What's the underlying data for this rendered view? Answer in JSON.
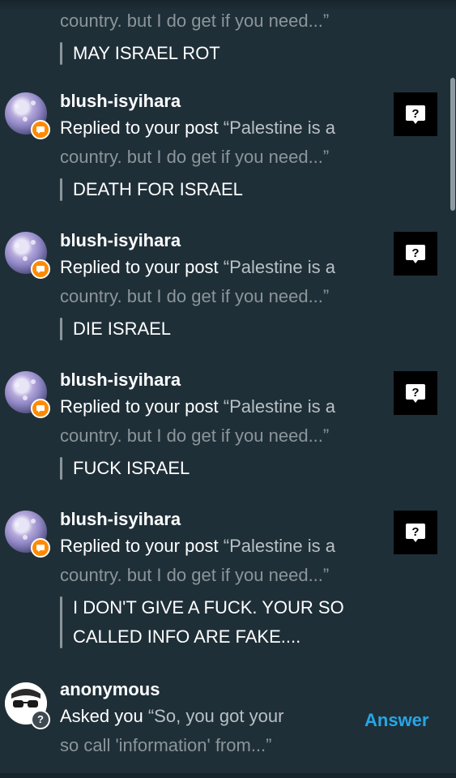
{
  "top_partial": {
    "line": "country. but I do get if you need...”",
    "reply": "MAY ISRAEL ROT"
  },
  "notifications": [
    {
      "username": "blush-isyihara",
      "action": "Replied to your post",
      "quote_start": "“Palestine is a",
      "quote_end": "country. but I do get if you need...”",
      "reply": "DEATH FOR ISRAEL"
    },
    {
      "username": "blush-isyihara",
      "action": "Replied to your post",
      "quote_start": "“Palestine is a",
      "quote_end": "country. but I do get if you need...”",
      "reply": "DIE ISRAEL"
    },
    {
      "username": "blush-isyihara",
      "action": "Replied to your post",
      "quote_start": "“Palestine is a",
      "quote_end": "country. but I do get if you need...”",
      "reply": "FUCK ISRAEL"
    },
    {
      "username": "blush-isyihara",
      "action": "Replied to your post",
      "quote_start": "“Palestine is a",
      "quote_end": "country. but I do get if you need...”",
      "reply_line1": "I DON'T GIVE A FUCK. YOUR SO",
      "reply_line2": "CALLED INFO ARE FAKE...."
    }
  ],
  "ask": {
    "username": "anonymous",
    "action": "Asked you",
    "quote_start": "“So, you got your",
    "quote_end": "so call 'information' from...”",
    "answer_label": "Answer"
  },
  "icons": {
    "reply_badge": "speech-bubble-icon",
    "post_thumbnail": "question-bubble-icon",
    "anon_avatar": "sunglasses-icon",
    "anon_badge": "question-icon"
  },
  "colors": {
    "background": "#1f2f38",
    "muted_text": "#8b959a",
    "badge_orange": "#ff8a00",
    "answer_blue": "#27a6e5"
  }
}
